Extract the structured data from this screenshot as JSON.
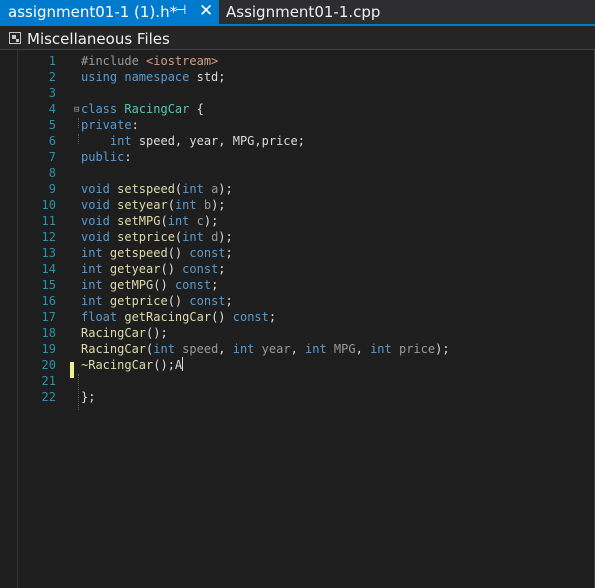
{
  "tabs": [
    {
      "label": "assignment01-1 (1).h*",
      "active": true,
      "pin_glyph": "⊣",
      "close_glyph": "✕"
    },
    {
      "label": "Assignment01-1.cpp",
      "active": false
    }
  ],
  "navbar": {
    "label": "Miscellaneous Files",
    "icon": "miscellaneous-files-icon"
  },
  "editor": {
    "lines": [
      {
        "n": "1",
        "tokens": [
          [
            "inc",
            "#include "
          ],
          [
            "str",
            "<iostream>"
          ]
        ]
      },
      {
        "n": "2",
        "tokens": [
          [
            "kw",
            "using "
          ],
          [
            "kw",
            "namespace "
          ],
          [
            "",
            "std;"
          ]
        ]
      },
      {
        "n": "3",
        "tokens": []
      },
      {
        "n": "4",
        "tokens": [
          [
            "kw",
            "class "
          ],
          [
            "ty",
            "RacingCar"
          ],
          [
            "",
            " {"
          ]
        ]
      },
      {
        "n": "5",
        "tokens": [
          [
            "kw",
            "private"
          ],
          [
            "",
            ":"
          ]
        ]
      },
      {
        "n": "6",
        "tokens": [
          [
            "",
            "    "
          ],
          [
            "kw",
            "int "
          ],
          [
            "",
            "speed, year, MPG,price;"
          ]
        ]
      },
      {
        "n": "7",
        "tokens": [
          [
            "kw",
            "public"
          ],
          [
            "",
            ":"
          ]
        ]
      },
      {
        "n": "8",
        "tokens": []
      },
      {
        "n": "9",
        "tokens": [
          [
            "kw",
            "void "
          ],
          [
            "fn",
            "setspeed"
          ],
          [
            "",
            "("
          ],
          [
            "kw",
            "int "
          ],
          [
            "pm",
            "a"
          ],
          [
            "",
            ");"
          ]
        ]
      },
      {
        "n": "10",
        "tokens": [
          [
            "kw",
            "void "
          ],
          [
            "fn",
            "setyear"
          ],
          [
            "",
            "("
          ],
          [
            "kw",
            "int "
          ],
          [
            "pm",
            "b"
          ],
          [
            "",
            ");"
          ]
        ]
      },
      {
        "n": "11",
        "tokens": [
          [
            "kw",
            "void "
          ],
          [
            "fn",
            "setMPG"
          ],
          [
            "",
            "("
          ],
          [
            "kw",
            "int "
          ],
          [
            "pm",
            "c"
          ],
          [
            "",
            ");"
          ]
        ]
      },
      {
        "n": "12",
        "tokens": [
          [
            "kw",
            "void "
          ],
          [
            "fn",
            "setprice"
          ],
          [
            "",
            "("
          ],
          [
            "kw",
            "int "
          ],
          [
            "pm",
            "d"
          ],
          [
            "",
            ");"
          ]
        ]
      },
      {
        "n": "13",
        "tokens": [
          [
            "kw",
            "int "
          ],
          [
            "fn",
            "getspeed"
          ],
          [
            "",
            "() "
          ],
          [
            "kw",
            "const"
          ],
          [
            "",
            ";"
          ]
        ]
      },
      {
        "n": "14",
        "tokens": [
          [
            "kw",
            "int "
          ],
          [
            "fn",
            "getyear"
          ],
          [
            "",
            "() "
          ],
          [
            "kw",
            "const"
          ],
          [
            "",
            ";"
          ]
        ]
      },
      {
        "n": "15",
        "tokens": [
          [
            "kw",
            "int "
          ],
          [
            "fn",
            "getMPG"
          ],
          [
            "",
            "() "
          ],
          [
            "kw",
            "const"
          ],
          [
            "",
            ";"
          ]
        ]
      },
      {
        "n": "16",
        "tokens": [
          [
            "kw",
            "int "
          ],
          [
            "fn",
            "getprice"
          ],
          [
            "",
            "() "
          ],
          [
            "kw",
            "const"
          ],
          [
            "",
            ";"
          ]
        ]
      },
      {
        "n": "17",
        "tokens": [
          [
            "kw",
            "float "
          ],
          [
            "fn",
            "getRacingCar"
          ],
          [
            "",
            "() "
          ],
          [
            "kw",
            "const"
          ],
          [
            "",
            ";"
          ]
        ]
      },
      {
        "n": "18",
        "tokens": [
          [
            "fn",
            "RacingCar"
          ],
          [
            "",
            "();"
          ]
        ]
      },
      {
        "n": "19",
        "tokens": [
          [
            "fn",
            "RacingCar"
          ],
          [
            "",
            "("
          ],
          [
            "kw",
            "int "
          ],
          [
            "pm",
            "speed"
          ],
          [
            "",
            ", "
          ],
          [
            "kw",
            "int "
          ],
          [
            "pm",
            "year"
          ],
          [
            "",
            ", "
          ],
          [
            "kw",
            "int "
          ],
          [
            "pm",
            "MPG"
          ],
          [
            "",
            ", "
          ],
          [
            "kw",
            "int "
          ],
          [
            "pm",
            "price"
          ],
          [
            "",
            ");"
          ]
        ]
      },
      {
        "n": "20",
        "tokens": [
          [
            "fn",
            "~RacingCar"
          ],
          [
            "",
            "();A"
          ]
        ],
        "caret": true
      },
      {
        "n": "21",
        "tokens": []
      },
      {
        "n": "22",
        "tokens": [
          [
            "",
            "};"
          ]
        ]
      }
    ]
  },
  "colors": {
    "accent": "#007acc",
    "keyword": "#569cd6",
    "type": "#4ec9b0",
    "function": "#dcdcaa",
    "line_number": "#2b91af",
    "change_marker": "#efef91"
  }
}
